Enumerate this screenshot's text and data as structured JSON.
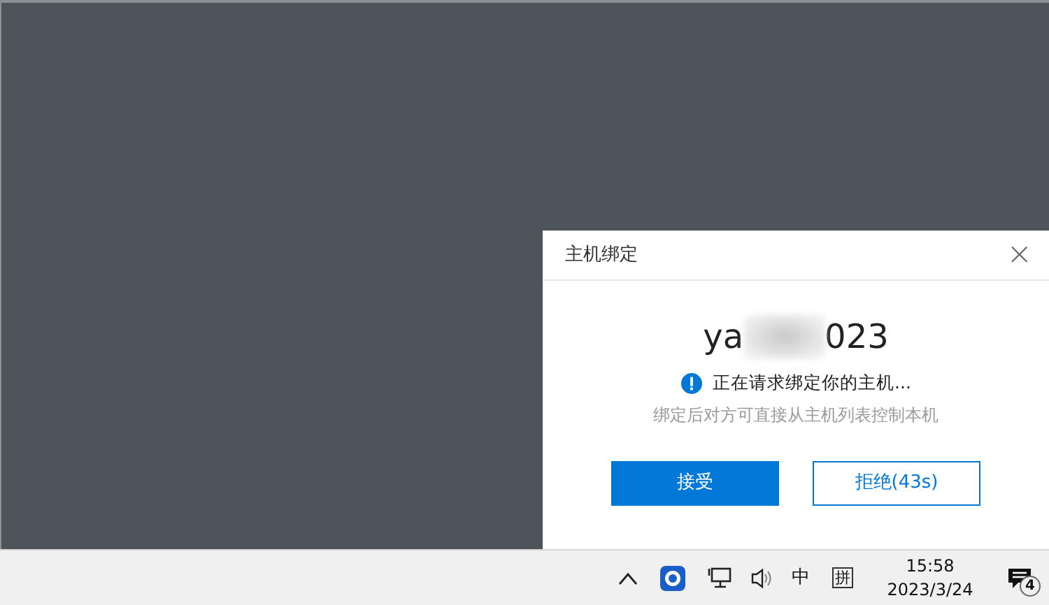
{
  "dialog": {
    "title": "主机绑定",
    "close": "×",
    "host_name_start": "ya",
    "host_name_end": "023",
    "message": "正在请求绑定你的主机...",
    "hint": "绑定后对方可直接从主机列表控制本机",
    "buttons": [
      {
        "label": "接受",
        "kind": "primary"
      },
      {
        "label": "拒绝(43s)",
        "kind": "outline"
      }
    ]
  },
  "taskbar": {
    "ime_mode": "中",
    "ime_name": "拼",
    "time": "15:58",
    "date": "2023/3/24",
    "notification_count": "4"
  }
}
